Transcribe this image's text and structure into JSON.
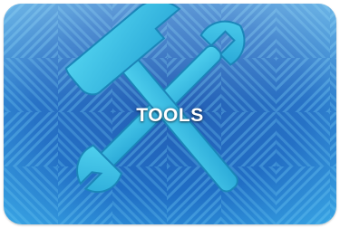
{
  "tile": {
    "label": "TOOLS",
    "icons": [
      "wrench-icon",
      "hammer-icon"
    ],
    "colors": {
      "background_light": "#35a6e6",
      "background_dark": "#0d3f8c",
      "pattern_light": "#5cc2f2",
      "icon_fill": "#38c0e8",
      "label": "#ffffff"
    }
  }
}
